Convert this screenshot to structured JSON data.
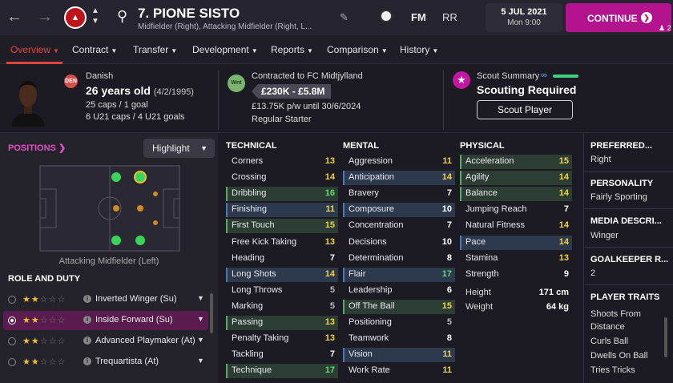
{
  "topbar": {
    "back_icon": "arrow-left-icon",
    "forward_icon": "arrow-right-icon",
    "player_title": "7. PIONE SISTO",
    "player_subtitle": "Midfielder (Right), Attacking Midfielder (Right, L...",
    "fm_label": "FM",
    "rr_label": "RR",
    "date": "5 JUL 2021",
    "time": "Mon 9:00",
    "continue_label": "CONTINUE",
    "continue_count": "2"
  },
  "menu": {
    "items": [
      {
        "label": "Overview"
      },
      {
        "label": "Contract"
      },
      {
        "label": "Transfer"
      },
      {
        "label": "Development"
      },
      {
        "label": "Reports"
      },
      {
        "label": "Comparison"
      },
      {
        "label": "History"
      }
    ]
  },
  "info": {
    "flag_code": "DEN",
    "nationality": "Danish",
    "age": "26 years old",
    "dob": "(4/2/1995)",
    "caps": "25 caps / 1 goal",
    "u21": "6 U21 caps / 4 U21 goals",
    "wnt_label": "Wnt",
    "contract": "Contracted to FC Midtjylland",
    "value": "£230K - £5.8M",
    "wage": "£13.75K p/w until 30/6/2024",
    "status": "Regular Starter",
    "scout_summary": "Scout Summary",
    "scout_required": "Scouting Required",
    "scout_button": "Scout Player"
  },
  "positions": {
    "title": "POSITIONS",
    "highlight": "Highlight",
    "pitch_label": "Attacking Midfielder (Left)"
  },
  "roles": {
    "title": "ROLE AND DUTY",
    "items": [
      {
        "name": "Inverted Winger (Su)",
        "stars": 2,
        "selected": false
      },
      {
        "name": "Inside Forward (Su)",
        "stars": 2,
        "selected": true
      },
      {
        "name": "Advanced Playmaker (At)",
        "stars": 2,
        "selected": false
      },
      {
        "name": "Trequartista (At)",
        "stars": 2,
        "selected": false
      }
    ]
  },
  "technical": {
    "title": "TECHNICAL",
    "attrs": [
      {
        "name": "Corners",
        "value": "13",
        "hl": ""
      },
      {
        "name": "Crossing",
        "value": "14",
        "hl": ""
      },
      {
        "name": "Dribbling",
        "value": "16",
        "hl": "green"
      },
      {
        "name": "Finishing",
        "value": "11",
        "hl": "blue"
      },
      {
        "name": "First Touch",
        "value": "15",
        "hl": "green"
      },
      {
        "name": "Free Kick Taking",
        "value": "13",
        "hl": ""
      },
      {
        "name": "Heading",
        "value": "7",
        "hl": ""
      },
      {
        "name": "Long Shots",
        "value": "14",
        "hl": "blue"
      },
      {
        "name": "Long Throws",
        "value": "5",
        "hl": ""
      },
      {
        "name": "Marking",
        "value": "5",
        "hl": ""
      },
      {
        "name": "Passing",
        "value": "13",
        "hl": "green"
      },
      {
        "name": "Penalty Taking",
        "value": "13",
        "hl": ""
      },
      {
        "name": "Tackling",
        "value": "7",
        "hl": ""
      },
      {
        "name": "Technique",
        "value": "17",
        "hl": "green"
      }
    ]
  },
  "mental": {
    "title": "MENTAL",
    "attrs": [
      {
        "name": "Aggression",
        "value": "11",
        "hl": ""
      },
      {
        "name": "Anticipation",
        "value": "14",
        "hl": "blue"
      },
      {
        "name": "Bravery",
        "value": "7",
        "hl": ""
      },
      {
        "name": "Composure",
        "value": "10",
        "hl": "blue"
      },
      {
        "name": "Concentration",
        "value": "7",
        "hl": ""
      },
      {
        "name": "Decisions",
        "value": "10",
        "hl": ""
      },
      {
        "name": "Determination",
        "value": "8",
        "hl": ""
      },
      {
        "name": "Flair",
        "value": "17",
        "hl": "blue"
      },
      {
        "name": "Leadership",
        "value": "6",
        "hl": ""
      },
      {
        "name": "Off The Ball",
        "value": "15",
        "hl": "green"
      },
      {
        "name": "Positioning",
        "value": "5",
        "hl": ""
      },
      {
        "name": "Teamwork",
        "value": "8",
        "hl": ""
      },
      {
        "name": "Vision",
        "value": "11",
        "hl": "blue"
      },
      {
        "name": "Work Rate",
        "value": "11",
        "hl": ""
      }
    ]
  },
  "physical": {
    "title": "PHYSICAL",
    "attrs": [
      {
        "name": "Acceleration",
        "value": "15",
        "hl": "green"
      },
      {
        "name": "Agility",
        "value": "14",
        "hl": "green"
      },
      {
        "name": "Balance",
        "value": "14",
        "hl": "green"
      },
      {
        "name": "Jumping Reach",
        "value": "7",
        "hl": ""
      },
      {
        "name": "Natural Fitness",
        "value": "14",
        "hl": ""
      },
      {
        "name": "Pace",
        "value": "14",
        "hl": "blue"
      },
      {
        "name": "Stamina",
        "value": "13",
        "hl": ""
      },
      {
        "name": "Strength",
        "value": "9",
        "hl": ""
      }
    ],
    "height_label": "Height",
    "height_value": "171 cm",
    "weight_label": "Weight",
    "weight_value": "64 kg"
  },
  "right_panel": {
    "preferred_title": "PREFERRED...",
    "preferred_value": "Right",
    "personality_title": "PERSONALITY",
    "personality_value": "Fairly Sporting",
    "media_title": "MEDIA DESCRI...",
    "media_value": "Winger",
    "gk_title": "GOALKEEPER R...",
    "gk_value": "2",
    "traits_title": "PLAYER TRAITS",
    "trait_1a": "Shoots From",
    "trait_1b": "Distance",
    "trait_2": "Curls Ball",
    "trait_3": "Dwells On Ball",
    "trait_4": "Tries Tricks"
  }
}
